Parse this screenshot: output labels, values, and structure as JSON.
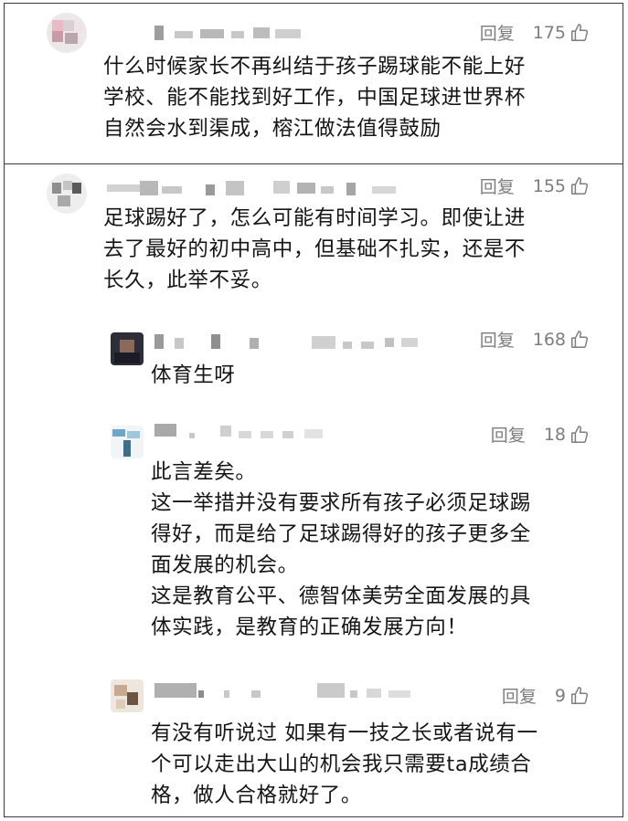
{
  "comments": [
    {
      "reply_label": "回复",
      "likes": "175",
      "lines": [
        "什么时候家长不再纠结于孩子踢球能不能上好",
        "学校、能不能找到好工作，中国足球进世界杯",
        "自然会水到渠成，榕江做法值得鼓励"
      ]
    },
    {
      "reply_label": "回复",
      "likes": "155",
      "lines": [
        "足球踢好了，怎么可能有时间学习。即使让进",
        "去了最好的初中高中，但基础不扎实，还是不",
        "长久，此举不妥。"
      ],
      "replies": [
        {
          "reply_label": "回复",
          "likes": "168",
          "lines": [
            "体育生呀"
          ]
        },
        {
          "reply_label": "回复",
          "likes": "18",
          "lines": [
            "此言差矣。",
            "这一举措并没有要求所有孩子必须足球踢",
            "得好，而是给了足球踢得好的孩子更多全",
            "面发展的机会。",
            "这是教育公平、德智体美劳全面发展的具",
            "体实践，是教育的正确发展方向！"
          ]
        },
        {
          "reply_label": "回复",
          "likes": "9",
          "lines": [
            "有没有听说过 如果有一技之长或者说有一",
            "个可以走出大山的机会我只需要ta成绩合",
            "格，做人合格就好了。"
          ]
        }
      ]
    }
  ],
  "icons": {
    "like": "thumbs-up-icon",
    "avatar": "blurred-avatar"
  },
  "colors": {
    "meta_gray": "#7d7d7d",
    "text": "#151515",
    "border": "#3a3a3a"
  }
}
